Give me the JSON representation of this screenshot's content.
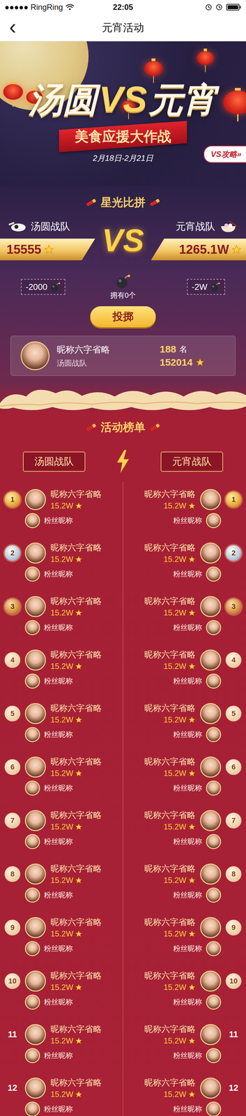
{
  "status_bar": {
    "carrier": "●●●●● RingRing",
    "time": "22:05"
  },
  "nav": {
    "back": "‹",
    "title": "元宵活动"
  },
  "banner": {
    "title_left": "汤圆",
    "vs": "VS",
    "title_right": "元宵",
    "subtitle": "美食应援大作战",
    "dates": "2月18日-2月21日",
    "guide": "VS攻略»"
  },
  "battle": {
    "heading": "星光比拼",
    "vs": "VS",
    "teams": [
      {
        "name": "汤圆战队",
        "score": "15555",
        "penalty": "-2000"
      },
      {
        "name": "元宵战队",
        "score": "1265.1W",
        "penalty": "-2W"
      }
    ],
    "bombs_owned": "拥有0个",
    "throw_button": "投掷"
  },
  "me": {
    "name": "昵称六字省略",
    "team": "汤圆战队",
    "rank": "188",
    "rank_unit": "名",
    "score": "152014"
  },
  "leaderboard": {
    "heading": "活动榜单",
    "tabs": [
      {
        "label": "汤圆战队"
      },
      {
        "label": "元宵战队"
      }
    ],
    "rows": [
      {
        "rank": "1",
        "kind": "gold",
        "left": {
          "name": "昵称六字省略",
          "score": "15.2W",
          "fan": "粉丝昵称"
        },
        "right": {
          "name": "昵称六字省略",
          "score": "15.2W",
          "fan": "粉丝昵称"
        }
      },
      {
        "rank": "2",
        "kind": "silver",
        "left": {
          "name": "昵称六字省略",
          "score": "15.2W",
          "fan": "粉丝昵称"
        },
        "right": {
          "name": "昵称六字省略",
          "score": "15.2W",
          "fan": "粉丝昵称"
        }
      },
      {
        "rank": "3",
        "kind": "bronze",
        "left": {
          "name": "昵称六字省略",
          "score": "15.2W",
          "fan": "粉丝昵称"
        },
        "right": {
          "name": "昵称六字省略",
          "score": "15.2W",
          "fan": "粉丝昵称"
        }
      },
      {
        "rank": "4",
        "kind": "circle",
        "left": {
          "name": "昵称六字省略",
          "score": "15.2W",
          "fan": "粉丝昵称"
        },
        "right": {
          "name": "昵称六字省略",
          "score": "15.2W",
          "fan": "粉丝昵称"
        }
      },
      {
        "rank": "5",
        "kind": "circle",
        "left": {
          "name": "昵称六字省略",
          "score": "15.2W",
          "fan": "粉丝昵称"
        },
        "right": {
          "name": "昵称六字省略",
          "score": "15.2W",
          "fan": "粉丝昵称"
        }
      },
      {
        "rank": "6",
        "kind": "circle",
        "left": {
          "name": "昵称六字省略",
          "score": "15.2W",
          "fan": "粉丝昵称"
        },
        "right": {
          "name": "昵称六字省略",
          "score": "15.2W",
          "fan": "粉丝昵称"
        }
      },
      {
        "rank": "7",
        "kind": "circle",
        "left": {
          "name": "昵称六字省略",
          "score": "15.2W",
          "fan": "粉丝昵称"
        },
        "right": {
          "name": "昵称六字省略",
          "score": "15.2W",
          "fan": "粉丝昵称"
        }
      },
      {
        "rank": "8",
        "kind": "circle",
        "left": {
          "name": "昵称六字省略",
          "score": "15.2W",
          "fan": "粉丝昵称"
        },
        "right": {
          "name": "昵称六字省略",
          "score": "15.2W",
          "fan": "粉丝昵称"
        }
      },
      {
        "rank": "9",
        "kind": "circle",
        "left": {
          "name": "昵称六字省略",
          "score": "15.2W",
          "fan": "粉丝昵称"
        },
        "right": {
          "name": "昵称六字省略",
          "score": "15.2W",
          "fan": "粉丝昵称"
        }
      },
      {
        "rank": "10",
        "kind": "circle",
        "left": {
          "name": "昵称六字省略",
          "score": "15.2W",
          "fan": "粉丝昵称"
        },
        "right": {
          "name": "昵称六字省略",
          "score": "15.2W",
          "fan": "粉丝昵称"
        }
      },
      {
        "rank": "11",
        "kind": "plain",
        "left": {
          "name": "昵称六字省略",
          "score": "15.2W",
          "fan": "粉丝昵称"
        },
        "right": {
          "name": "昵称六字省略",
          "score": "15.2W",
          "fan": "粉丝昵称"
        }
      },
      {
        "rank": "12",
        "kind": "plain",
        "left": {
          "name": "昵称六字省略",
          "score": "15.2W",
          "fan": "粉丝昵称"
        },
        "right": {
          "name": "昵称六字省略",
          "score": "15.2W",
          "fan": "粉丝昵称"
        }
      }
    ]
  }
}
